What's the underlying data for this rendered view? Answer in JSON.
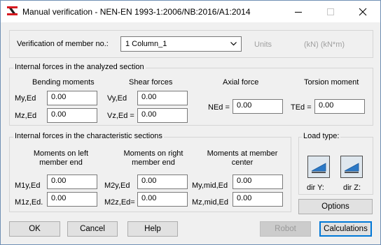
{
  "window": {
    "title": "Manual verification - NEN-EN 1993-1:2006/NB:2016/A1:2014",
    "icon": "app-logo-icon",
    "controls": [
      "minimize-icon",
      "maximize-icon",
      "close-icon"
    ]
  },
  "member": {
    "label": "Verification of member no.:",
    "value": "1 Column_1",
    "units_label": "Units",
    "units_value": "(kN) (kN*m)"
  },
  "analyzed": {
    "group_title": "Internal forces in the analyzed section",
    "bending": {
      "header": "Bending moments",
      "my_label": "My,Ed",
      "my_value": "0.00",
      "mz_label": "Mz,Ed",
      "mz_value": "0.00"
    },
    "shear": {
      "header": "Shear forces",
      "vy_label": "Vy,Ed",
      "vy_value": "0.00",
      "vz_label": "Vz,Ed =",
      "vz_value": "0.00"
    },
    "axial": {
      "header": "Axial force",
      "label": "NEd =",
      "value": "0.00"
    },
    "torsion": {
      "header": "Torsion moment",
      "label": "TEd =",
      "value": "0.00"
    }
  },
  "characteristic": {
    "group_title": "Internal forces in the characteristic sections",
    "left": {
      "header_line1": "Moments on left",
      "header_line2": "member end",
      "m1y_label": "M1y,Ed",
      "m1y_value": "0.00",
      "m1z_label": "M1z,Ed.",
      "m1z_value": "0.00"
    },
    "right": {
      "header_line1": "Moments on right",
      "header_line2": "member end",
      "m2y_label": "M2y,Ed",
      "m2y_value": "0.00",
      "m2z_label": "M2z,Ed=",
      "m2z_value": "0.00"
    },
    "center": {
      "header_line1": "Moments at member",
      "header_line2": "center",
      "mymid_label": "My,mid,Ed",
      "mymid_value": "0.00",
      "mzmid_label": "Mz,mid,Ed",
      "mzmid_value": "0.00"
    }
  },
  "load_type": {
    "title": "Load type:",
    "dir_y_label": "dir Y:",
    "dir_z_label": "dir Z:",
    "dir_y_icon": "load-direction-y-icon",
    "dir_z_icon": "load-direction-z-icon"
  },
  "buttons": {
    "options": "Options",
    "ok": "OK",
    "cancel": "Cancel",
    "help": "Help",
    "robot": "Robot",
    "calculations": "Calculations"
  },
  "colors": {
    "accent": "#0078d7",
    "window_bg": "#f0f0f0",
    "icon_red": "#d71920",
    "load_icon_blue": "#2a78c6"
  }
}
